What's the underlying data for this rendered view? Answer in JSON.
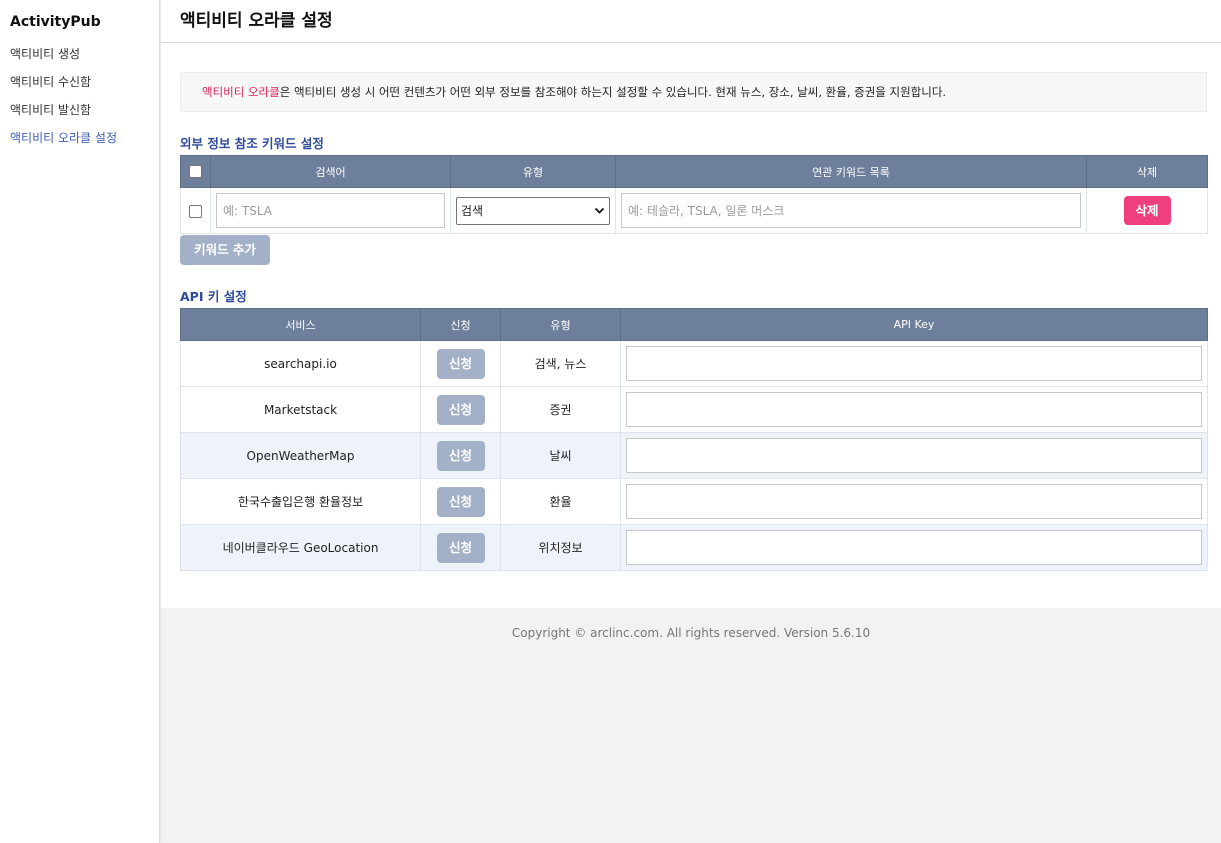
{
  "sidebar": {
    "brand": "ActivityPub",
    "items": [
      {
        "label": "액티비티 생성"
      },
      {
        "label": "액티비티 수신함"
      },
      {
        "label": "액티비티 발신함"
      },
      {
        "label": "액티비티 오라클 설정"
      }
    ],
    "active_index": 3
  },
  "header": {
    "title": "액티비티 오라클 설정"
  },
  "info": {
    "highlight": "액티비티 오라클",
    "text": "은 액티비티 생성 시 어떤 컨텐츠가 어떤 외부 정보를 참조해야 하는지 설정할 수 있습니다. 현재 뉴스, 장소, 날씨, 환율, 증권을 지원합니다."
  },
  "keyword_section": {
    "title": "외부 정보 참조 키워드 설정",
    "columns": [
      "검색어",
      "유형",
      "연관 키워드 목록",
      "삭제"
    ],
    "row": {
      "query_placeholder": "예: TSLA",
      "type_selected": "검색",
      "related_placeholder": "예: 테슬라, TSLA, 일론 머스크",
      "delete_label": "삭제"
    },
    "add_label": "키워드 추가"
  },
  "api_section": {
    "title": "API 키 설정",
    "columns": [
      "서비스",
      "신청",
      "유형",
      "API Key"
    ],
    "apply_label": "신청",
    "rows": [
      {
        "service": "searchapi.io",
        "type": "검색, 뉴스"
      },
      {
        "service": "Marketstack",
        "type": "증권"
      },
      {
        "service": "OpenWeatherMap",
        "type": "날씨"
      },
      {
        "service": "한국수출입은행 환율정보",
        "type": "환율"
      },
      {
        "service": "네이버클라우드 GeoLocation",
        "type": "위치정보"
      }
    ]
  },
  "footer": {
    "text": "Copyright © arclinc.com. All rights reserved. Version 5.6.10"
  }
}
